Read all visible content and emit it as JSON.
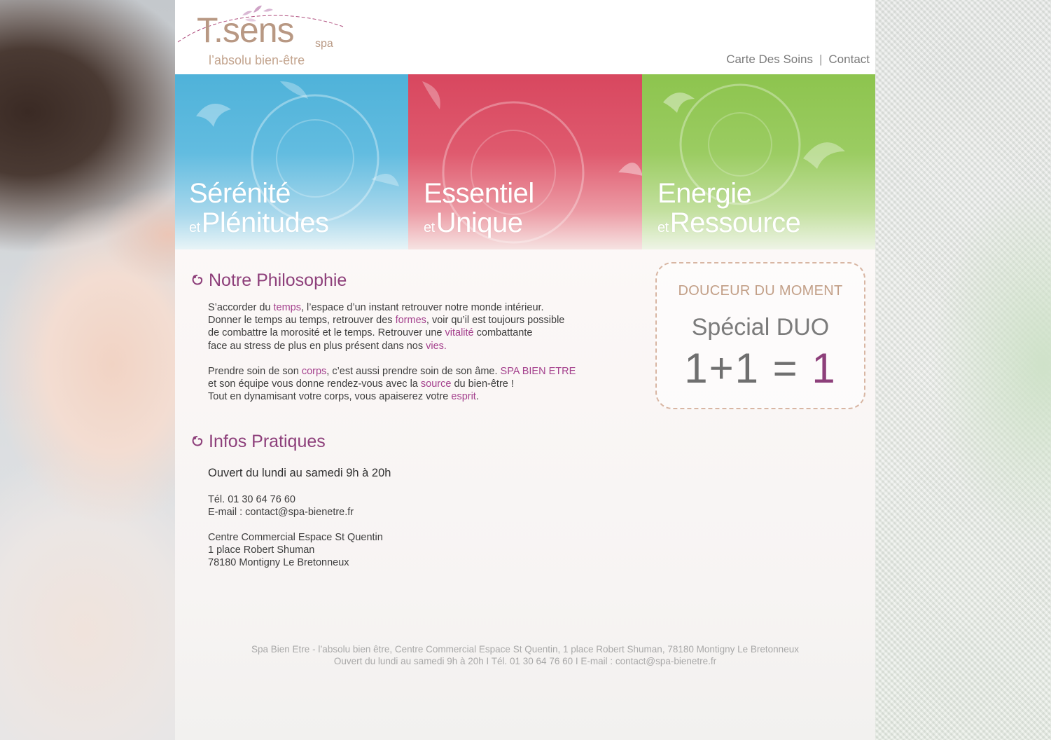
{
  "brand": {
    "logo_main": "T.sens",
    "logo_spa": "spa",
    "tagline": "l’absolu bien-être"
  },
  "nav": {
    "items": [
      {
        "label": "Carte Des Soins"
      },
      {
        "label": "Contact"
      }
    ],
    "separator": "|"
  },
  "banner": {
    "panels": [
      {
        "line1": "Sérénité",
        "et": "et",
        "line2": "Plénitudes",
        "color": "#4fb2d9"
      },
      {
        "line1": "Essentiel",
        "et": "et",
        "line2": "Unique",
        "color": "#d8475f"
      },
      {
        "line1": "Energie",
        "et": "et",
        "line2": "Ressource",
        "color": "#8dc44e"
      }
    ]
  },
  "philosophy": {
    "heading": "Notre Philosophie",
    "p1": {
      "s1": "S’accorder du ",
      "h1": "temps",
      "s2": ",  l’espace d’un instant retrouver notre monde intérieur.",
      "s3": "Donner le temps au temps, retrouver des ",
      "h2": "formes",
      "s4": ", voir qu’il est toujours possible",
      "s5": "de combattre la morosité et le temps. Retrouver une ",
      "h3": "vitalité",
      "s6": " combattante",
      "s7": "face au stress de plus en plus présent dans nos ",
      "h4": "vies."
    },
    "p2": {
      "s1": "Prendre soin de son ",
      "h1": "corps",
      "s2": ", c’est aussi prendre soin de son âme. ",
      "h2": "SPA BIEN ETRE",
      "s3": "et son équipe vous donne rendez-vous avec la ",
      "h3": "source",
      "s4": " du bien-être !",
      "s5": "Tout en dynamisant votre corps, vous apaiserez votre ",
      "h4": "esprit",
      "s6": "."
    }
  },
  "infos": {
    "heading": "Infos Pratiques",
    "hours": "Ouvert du lundi au samedi 9h à 20h",
    "tel": "Tél. 01 30 64 76 60",
    "email": "E-mail : contact@spa-bienetre.fr",
    "address1": "Centre Commercial Espace St Quentin",
    "address2": "1 place Robert Shuman",
    "address3": "78180 Montigny Le Bretonneux"
  },
  "promo": {
    "heading": "DOUCEUR DU MOMENT",
    "subtitle": "Spécial DUO",
    "equation": "1+1 = ",
    "result": "1"
  },
  "footer": {
    "line1": "Spa Bien Etre - l’absolu bien être, Centre Commercial Espace St Quentin, 1 place Robert Shuman, 78180 Montigny Le Bretonneux",
    "line2": "Ouvert du lundi au samedi 9h à 20h  I  Tél. 01 30 64 76 60  I  E-mail : contact@spa-bienetre.fr"
  },
  "colors": {
    "accent": "#8d3f7a",
    "highlight": "#a4408d",
    "logo": "#b89883"
  }
}
